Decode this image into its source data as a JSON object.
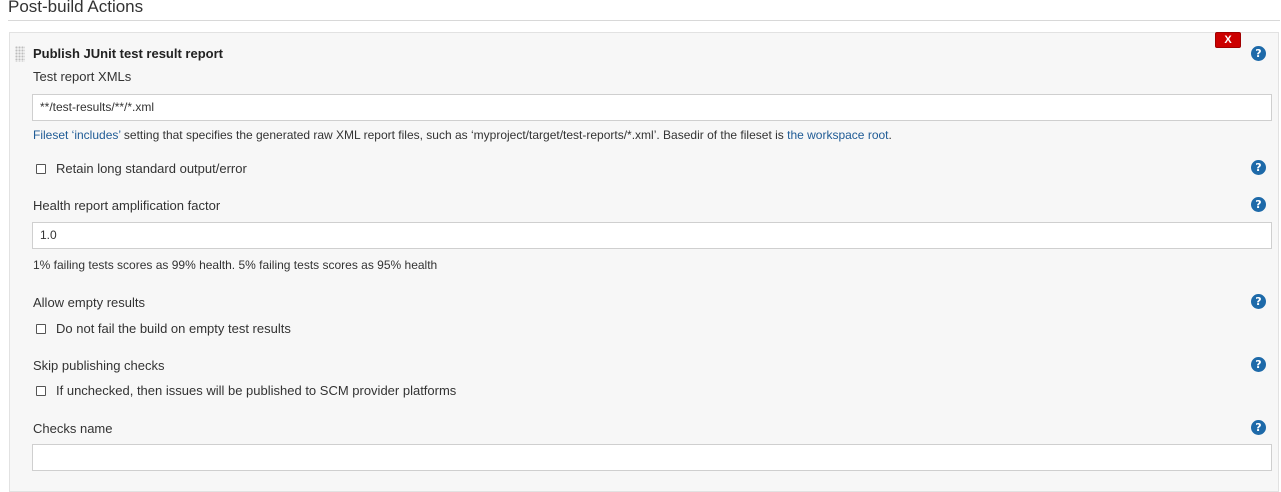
{
  "section": {
    "title": "Post-build Actions"
  },
  "block": {
    "title": "Publish JUnit test result report",
    "delete_label": "X",
    "help_glyph": "?"
  },
  "test_report": {
    "label": "Test report XMLs",
    "value": "**/test-results/**/*.xml",
    "hint_link1": "Fileset ‘includes’",
    "hint_mid": " setting that specifies the generated raw XML report files, such as ‘myproject/target/test-reports/*.xml’. Basedir of the fileset is ",
    "hint_link2": "the workspace root",
    "hint_end": "."
  },
  "retain": {
    "label": "Retain long standard output/error",
    "checked": false
  },
  "health": {
    "label": "Health report amplification factor",
    "value": "1.0",
    "hint": "1% failing tests scores as 99% health. 5% failing tests scores as 95% health"
  },
  "allow_empty": {
    "label": "Allow empty results",
    "checkbox_label": "Do not fail the build on empty test results",
    "checked": false
  },
  "skip_checks": {
    "label": "Skip publishing checks",
    "checkbox_label": "If unchecked, then issues will be published to SCM provider platforms",
    "checked": false
  },
  "checks_name": {
    "label": "Checks name",
    "value": ""
  },
  "colors": {
    "help": "#1e6aa9",
    "delete": "#cc0000",
    "link": "#1f5b95"
  },
  "icons": {
    "help": "question-circle-icon",
    "drag": "drag-handle-icon"
  }
}
